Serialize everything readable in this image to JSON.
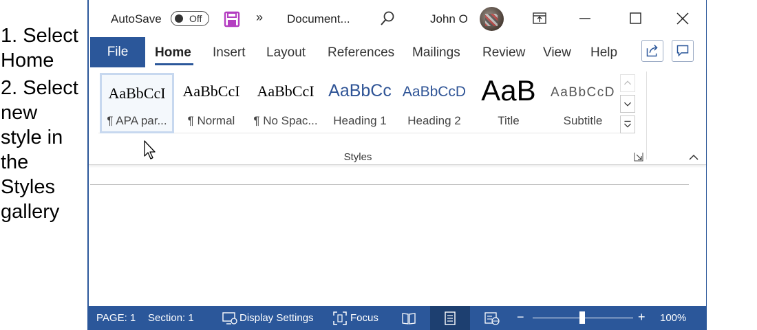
{
  "annotation": {
    "step1": "1. Select\nHome",
    "step2": "2. Select\nnew\nstyle in\nthe\nStyles\ngallery"
  },
  "titlebar": {
    "autosave_label": "AutoSave",
    "autosave_state": "Off",
    "more_glyph": "»",
    "document_name": "Document...",
    "user_name": "John O"
  },
  "tabs": {
    "file": "File",
    "items": [
      "Home",
      "Insert",
      "Layout",
      "References",
      "Mailings",
      "Review",
      "View",
      "Help"
    ],
    "active": "Home"
  },
  "styles_gallery": {
    "group_label": "Styles",
    "items": [
      {
        "preview": "AaBbCcI",
        "name": "¶ APA par...",
        "selected": true
      },
      {
        "preview": "AaBbCcI",
        "name": "¶ Normal"
      },
      {
        "preview": "AaBbCcI",
        "name": "¶ No Spac..."
      },
      {
        "preview": "AaBbCc",
        "name": "Heading 1"
      },
      {
        "preview": "AaBbCcD",
        "name": "Heading 2"
      },
      {
        "preview": "AaB",
        "name": "Title"
      },
      {
        "preview": "AaBbCcD",
        "name": "Subtitle"
      }
    ]
  },
  "statusbar": {
    "page": "PAGE: 1",
    "section": "Section: 1",
    "display_settings": "Display Settings",
    "focus": "Focus",
    "zoom_minus": "−",
    "zoom_plus": "+",
    "zoom_level": "100%"
  },
  "colors": {
    "accent": "#2b579a",
    "save_icon": "#b43ec1",
    "heading_blue": "#2f5496"
  }
}
